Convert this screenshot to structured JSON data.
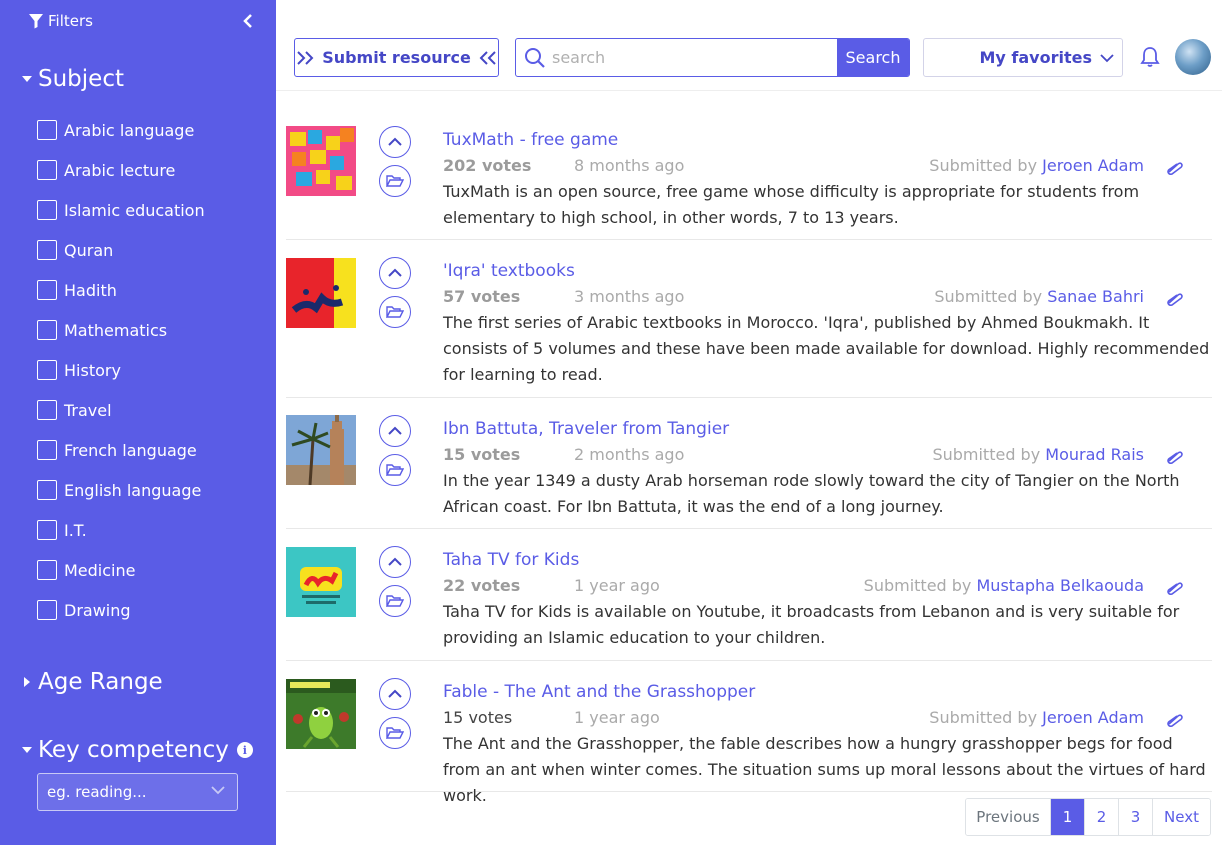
{
  "colors": {
    "accent": "#5a5ce6",
    "sidebar_bg": "#5a5ce6",
    "muted": "#aaaaaa"
  },
  "sidebar": {
    "filters_label": "Filters",
    "subject": {
      "title": "Subject",
      "items": [
        "Arabic language",
        "Arabic lecture",
        "Islamic education",
        "Quran",
        "Hadith",
        "Mathematics",
        "History",
        "Travel",
        "French language",
        "English language",
        "I.T.",
        "Medicine",
        "Drawing"
      ]
    },
    "age_range": {
      "title": "Age Range"
    },
    "key_competency": {
      "title": "Key competency",
      "info": "i",
      "placeholder": "eg. reading..."
    }
  },
  "topbar": {
    "submit_label": "Submit resource",
    "search_placeholder": "search",
    "search_button": "Search",
    "favorites_label": "My favorites"
  },
  "resources": [
    {
      "title": "TuxMath - free game",
      "votes": "202 votes",
      "time": "8 months ago",
      "submitted_by": "Submitted by",
      "author": "Jeroen Adam",
      "description": "TuxMath is an open source, free game whose difficulty is appropriate for students from elementary to high school, in other words, 7 to 13 years.",
      "thumb": "math-blocks"
    },
    {
      "title": "'Iqra' textbooks",
      "votes": "57 votes",
      "time": "3 months ago",
      "submitted_by": "Submitted by",
      "author": "Sanae Bahri",
      "description": "The first series of Arabic textbooks in Morocco. 'Iqra', published by Ahmed Boukmakh. It consists of 5 volumes and these have been made available for download. Highly recommended for learning to read.",
      "thumb": "iqra-cover"
    },
    {
      "title": "Ibn Battuta, Traveler from Tangier",
      "votes": "15 votes",
      "time": "2 months ago",
      "submitted_by": "Submitted by",
      "author": "Mourad Rais",
      "description": "In the year 1349 a dusty Arab horseman rode slowly toward the city of Tangier on the North African coast. For Ibn Battuta, it was the end of a long journey.",
      "thumb": "minaret-palm"
    },
    {
      "title": "Taha TV for Kids",
      "votes": "22 votes",
      "time": "1 year ago",
      "submitted_by": "Submitted by",
      "author": "Mustapha Belkaouda",
      "description": "Taha TV for Kids is available on Youtube, it broadcasts from Lebanon and is very suitable for providing an Islamic education to your children.",
      "thumb": "taha-tv-logo"
    },
    {
      "title": "Fable - The Ant and the Grasshopper",
      "votes": "15 votes",
      "time": "1 year ago",
      "submitted_by": "Submitted by",
      "author": "Jeroen Adam",
      "description": "The Ant and the Grasshopper, the fable describes how a hungry grasshopper begs for food from an ant when winter comes. The situation sums up moral lessons about the virtues of hard work.",
      "thumb": "grasshopper-cartoon"
    }
  ],
  "pagination": {
    "previous": "Previous",
    "pages": [
      "1",
      "2",
      "3"
    ],
    "current": "1",
    "next": "Next"
  }
}
